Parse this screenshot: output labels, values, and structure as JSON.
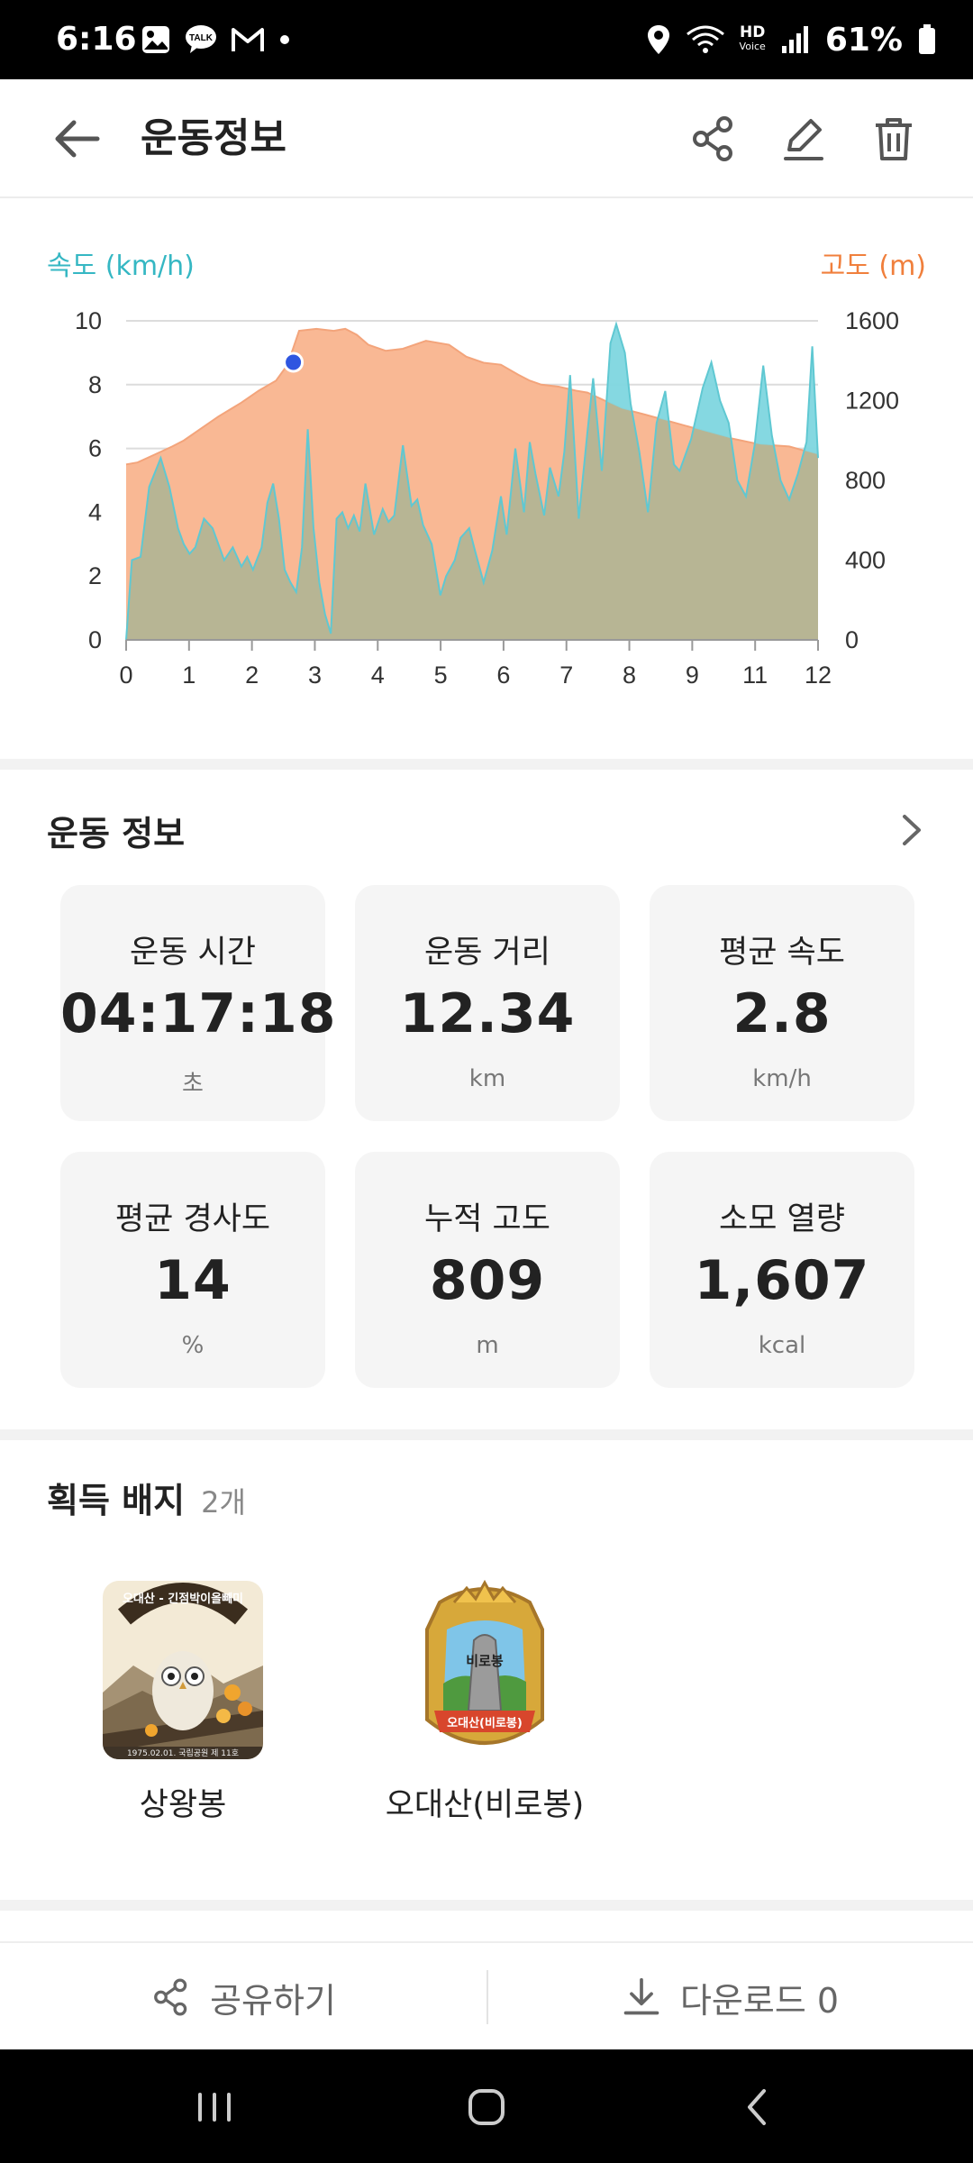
{
  "status_bar": {
    "time": "6:16",
    "battery": "61%",
    "left_icons": [
      "gallery-icon",
      "kakaotalk-icon",
      "gmail-icon",
      "dot-icon"
    ],
    "right_icons": [
      "location-icon",
      "wifi-icon",
      "hd-voice-icon",
      "signal-icon",
      "battery-icon"
    ],
    "hd_label": "HD",
    "voice_label": "Voice"
  },
  "header": {
    "title": "운동정보",
    "actions": [
      "share-icon",
      "edit-icon",
      "trash-icon"
    ]
  },
  "chart": {
    "left_axis_title": "속도 (km/h)",
    "right_axis_title": "고도 (m)",
    "colors": {
      "speed": "#7ed6df",
      "altitude": "#f9b894",
      "overlap": "#b7b594",
      "marker": "#2f56e0"
    }
  },
  "chart_data": {
    "type": "area",
    "x_tick_labels": [
      "0",
      "1",
      "2",
      "3",
      "4",
      "5",
      "6",
      "7",
      "8",
      "9",
      "11",
      "12"
    ],
    "xlim": [
      0,
      12
    ],
    "left_axis": {
      "label": "속도 (km/h)",
      "ylim": [
        0,
        10
      ],
      "ticks": [
        "0",
        "2",
        "4",
        "6",
        "8",
        "10"
      ]
    },
    "right_axis": {
      "label": "고도 (m)",
      "ylim": [
        0,
        1600
      ],
      "ticks": [
        "0",
        "400",
        "800",
        "1200",
        "1600"
      ]
    },
    "grid": true,
    "marker": {
      "x": 2.9,
      "y_speed": 8.7
    },
    "series": [
      {
        "name": "고도 (m)",
        "axis": "right",
        "x": [
          0,
          0.2,
          0.5,
          0.8,
          1.0,
          1.3,
          1.6,
          2.0,
          2.3,
          2.6,
          2.8,
          3.0,
          3.3,
          3.6,
          3.8,
          4.0,
          4.2,
          4.5,
          4.8,
          5.2,
          5.6,
          5.9,
          6.2,
          6.5,
          6.8,
          7.0,
          7.2,
          7.5,
          7.8,
          8.0,
          8.3,
          8.6,
          9.0,
          9.5,
          10.0,
          10.5,
          11.0,
          11.5,
          12.0
        ],
        "values": [
          880,
          890,
          930,
          970,
          1000,
          1060,
          1120,
          1190,
          1250,
          1300,
          1380,
          1550,
          1560,
          1550,
          1560,
          1530,
          1480,
          1450,
          1460,
          1500,
          1480,
          1420,
          1390,
          1380,
          1330,
          1300,
          1280,
          1270,
          1250,
          1240,
          1200,
          1160,
          1130,
          1090,
          1050,
          1010,
          980,
          970,
          930
        ]
      },
      {
        "name": "속도 (km/h)",
        "axis": "left",
        "x": [
          0,
          0.1,
          0.25,
          0.4,
          0.6,
          0.75,
          0.9,
          1.0,
          1.1,
          1.2,
          1.35,
          1.5,
          1.7,
          1.85,
          2.0,
          2.1,
          2.2,
          2.35,
          2.45,
          2.55,
          2.65,
          2.75,
          2.85,
          2.95,
          3.05,
          3.15,
          3.25,
          3.35,
          3.45,
          3.55,
          3.65,
          3.75,
          3.85,
          3.95,
          4.05,
          4.15,
          4.3,
          4.45,
          4.55,
          4.65,
          4.8,
          4.95,
          5.05,
          5.15,
          5.3,
          5.45,
          5.55,
          5.7,
          5.8,
          5.95,
          6.05,
          6.2,
          6.35,
          6.5,
          6.6,
          6.75,
          6.9,
          7.0,
          7.1,
          7.25,
          7.35,
          7.5,
          7.6,
          7.7,
          7.85,
          8.0,
          8.1,
          8.25,
          8.4,
          8.5,
          8.65,
          8.75,
          8.9,
          9.05,
          9.2,
          9.35,
          9.5,
          9.6,
          9.8,
          10.0,
          10.15,
          10.3,
          10.45,
          10.6,
          10.75,
          10.9,
          11.05,
          11.2,
          11.35,
          11.5,
          11.65,
          11.8,
          11.9,
          12.0
        ],
        "values": [
          0,
          2.5,
          2.6,
          4.8,
          5.7,
          4.8,
          3.5,
          3.0,
          2.7,
          2.9,
          3.8,
          3.5,
          2.5,
          2.9,
          2.3,
          2.6,
          2.2,
          2.9,
          4.3,
          4.9,
          3.8,
          2.2,
          1.8,
          1.5,
          2.9,
          6.6,
          3.5,
          1.8,
          0.8,
          0.2,
          3.8,
          4.0,
          3.5,
          3.9,
          3.4,
          4.9,
          3.3,
          4.1,
          3.7,
          3.9,
          6.1,
          4.2,
          4.4,
          3.6,
          3.0,
          1.4,
          2.0,
          2.5,
          3.2,
          3.5,
          2.8,
          1.8,
          2.8,
          4.5,
          3.3,
          6.0,
          4.0,
          6.2,
          5.2,
          3.9,
          5.4,
          4.5,
          5.9,
          8.3,
          3.8,
          6.5,
          8.2,
          5.3,
          9.3,
          9.9,
          9.0,
          7.4,
          5.9,
          4.0,
          6.8,
          7.8,
          5.5,
          5.3,
          6.3,
          7.9,
          8.7,
          7.5,
          6.8,
          5.0,
          4.5,
          6.1,
          8.6,
          6.4,
          5.0,
          4.4,
          5.2,
          6.2,
          9.2,
          5.7
        ]
      }
    ]
  },
  "workout_info": {
    "title": "운동 정보",
    "stats": [
      {
        "label": "운동 시간",
        "value": "04:17:18",
        "unit": "초"
      },
      {
        "label": "운동 거리",
        "value": "12.34",
        "unit": "km"
      },
      {
        "label": "평균 속도",
        "value": "2.8",
        "unit": "km/h"
      },
      {
        "label": "평균 경사도",
        "value": "14",
        "unit": "%"
      },
      {
        "label": "누적 고도",
        "value": "809",
        "unit": "m"
      },
      {
        "label": "소모 열량",
        "value": "1,607",
        "unit": "kcal"
      }
    ]
  },
  "badges": {
    "title": "획득 배지",
    "count": "2개",
    "items": [
      {
        "name": "상왕봉",
        "art_text": "오대산 - 긴점박이올빼미",
        "art_caption": "1975.02.01. 국립공원 제 11호"
      },
      {
        "name": "오대산(비로봉)",
        "art_text": "비로봉",
        "art_banner": "오대산(비로봉)"
      }
    ]
  },
  "bottom_bar": {
    "share_label": "공유하기",
    "download_label": "다운로드 0"
  },
  "nav_bar": {
    "buttons": [
      "recents-icon",
      "home-icon",
      "back-nav-icon"
    ]
  }
}
